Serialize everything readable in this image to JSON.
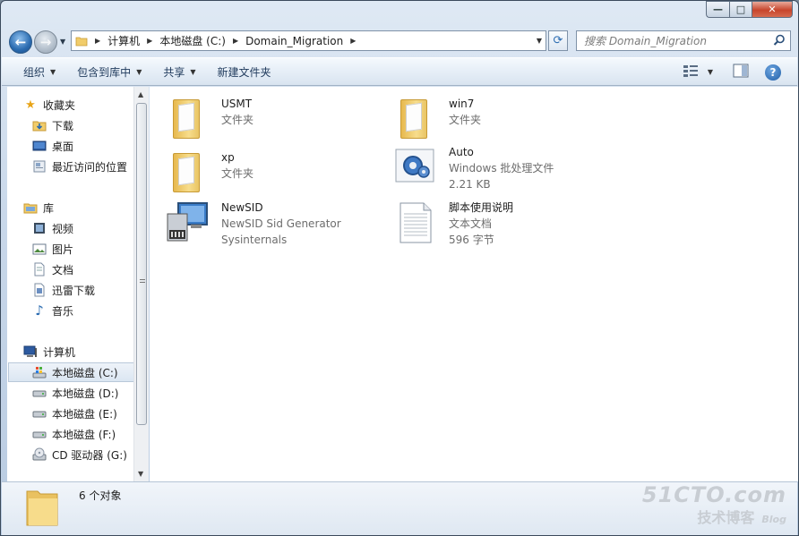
{
  "window": {
    "caption_buttons": {
      "minimize": "—",
      "maximize": "□",
      "close": "✕"
    }
  },
  "address": {
    "breadcrumbs": [
      "计算机",
      "本地磁盘 (C:)",
      "Domain_Migration"
    ],
    "search_placeholder": "搜索 Domain_Migration"
  },
  "toolbar": {
    "organize": "组织",
    "include_in_library": "包含到库中",
    "share": "共享",
    "new_folder": "新建文件夹"
  },
  "navigation": {
    "favorites": {
      "header": "收藏夹",
      "items": [
        "下载",
        "桌面",
        "最近访问的位置"
      ]
    },
    "libraries": {
      "header": "库",
      "items": [
        "视频",
        "图片",
        "文档",
        "迅雷下载",
        "音乐"
      ]
    },
    "computer": {
      "header": "计算机",
      "items": [
        "本地磁盘 (C:)",
        "本地磁盘 (D:)",
        "本地磁盘 (E:)",
        "本地磁盘 (F:)",
        "CD 驱动器 (G:)"
      ],
      "selected": "本地磁盘 (C:)"
    }
  },
  "files": [
    {
      "name": "USMT",
      "line2": "文件夹",
      "line3": "",
      "icon": "folder-icon"
    },
    {
      "name": "win7",
      "line2": "文件夹",
      "line3": "",
      "icon": "folder-icon"
    },
    {
      "name": "xp",
      "line2": "文件夹",
      "line3": "",
      "icon": "folder-icon"
    },
    {
      "name": "Auto",
      "line2": "Windows 批处理文件",
      "line3": "2.21 KB",
      "icon": "batch-file-icon"
    },
    {
      "name": "NewSID",
      "line2": "NewSID Sid Generator",
      "line3": "Sysinternals",
      "icon": "application-icon"
    },
    {
      "name": "脚本使用说明",
      "line2": "文本文档",
      "line3": "596 字节",
      "icon": "text-document-icon"
    }
  ],
  "details": {
    "count": "6 个对象"
  },
  "watermark": {
    "line1": "51CTO.com",
    "line2": "技术博客",
    "line3": "Blog"
  },
  "colors": {
    "accent": "#2a6bb0",
    "folder": "#f1cc6a",
    "window_frame": "#c9d8ea"
  }
}
